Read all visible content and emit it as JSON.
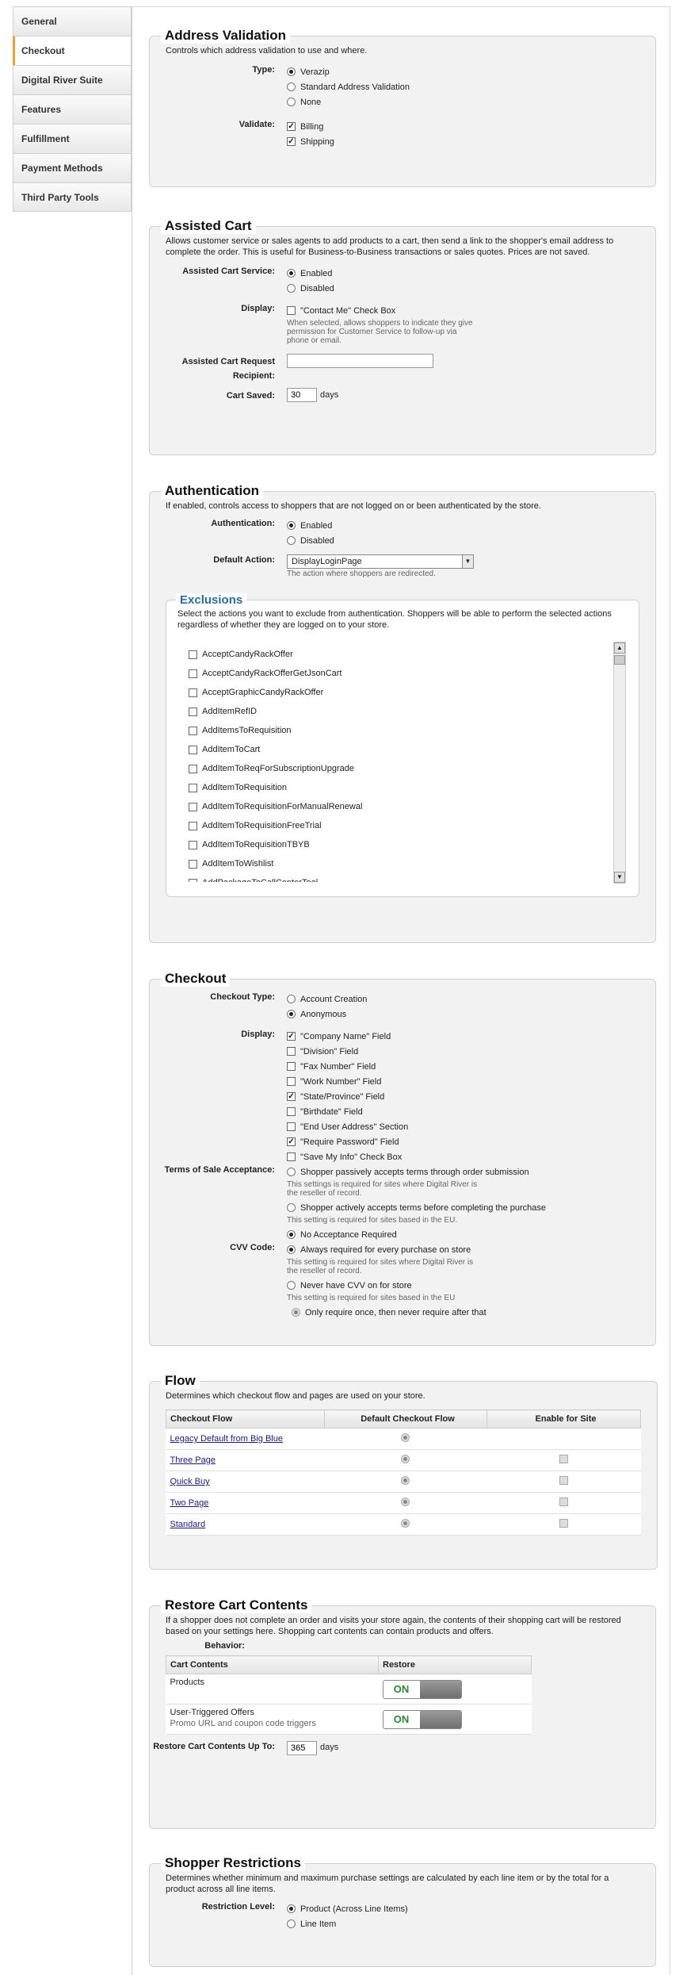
{
  "nav": {
    "items": [
      "General",
      "Checkout",
      "Digital River Suite",
      "Features",
      "Fulfillment",
      "Payment Methods",
      "Third Party Tools"
    ],
    "active_index": 1
  },
  "address_validation": {
    "title": "Address Validation",
    "description": "Controls which address validation to use and where.",
    "type_label": "Type:",
    "type_options": [
      "Verazip",
      "Standard Address Validation",
      "None"
    ],
    "type_selected": 0,
    "validate_label": "Validate:",
    "validate_options": [
      "Billing",
      "Shipping"
    ]
  },
  "assisted_cart": {
    "title": "Assisted Cart",
    "description": "Allows customer service or sales agents to add products to a cart, then send a link to the shopper's email address to complete the order. This is useful for Business-to-Business transactions or sales quotes. Prices are not saved.",
    "service_label": "Assisted Cart Service:",
    "service_options": [
      "Enabled",
      "Disabled"
    ],
    "display_label": "Display:",
    "contact_me": "\"Contact Me\" Check Box",
    "contact_hint": "When selected, allows shoppers to indicate they give permission for Customer Service to follow-up via phone or email.",
    "recipient_label": "Assisted Cart Request Recipient:",
    "recipient_value": "",
    "saved_label": "Cart Saved:",
    "saved_value": "30",
    "saved_unit": "days"
  },
  "authentication": {
    "title": "Authentication",
    "description": "If enabled, controls access to shoppers that are not logged on or been authenticated by the store.",
    "auth_label": "Authentication:",
    "auth_options": [
      "Enabled",
      "Disabled"
    ],
    "default_action_label": "Default Action:",
    "default_action_value": "DisplayLoginPage",
    "default_action_hint": "The action where shoppers are redirected.",
    "exclusions": {
      "title": "Exclusions",
      "description": "Select the actions you want to exclude from authentication. Shoppers will be able to perform the selected actions regardless of whether they are logged on to your store.",
      "items": [
        "AcceptCandyRackOffer",
        "AcceptCandyRackOfferGetJsonCart",
        "AcceptGraphicCandyRackOffer",
        "AddItemRefID",
        "AddItemsToRequisition",
        "AddItemToCart",
        "AddItemToReqForSubscriptionUpgrade",
        "AddItemToRequisition",
        "AddItemToRequisitionForManualRenewal",
        "AddItemToRequisitionFreeTrial",
        "AddItemToRequisitionTBYB",
        "AddItemToWishlist",
        "AddPackageToCallCenterTool"
      ]
    }
  },
  "checkout": {
    "title": "Checkout",
    "type_label": "Checkout Type:",
    "type_options": [
      "Account Creation",
      "Anonymous"
    ],
    "display_label": "Display:",
    "display_options": [
      {
        "label": "\"Company Name\" Field",
        "checked": true
      },
      {
        "label": "\"Division\" Field",
        "checked": false
      },
      {
        "label": "\"Fax Number\" Field",
        "checked": false
      },
      {
        "label": "\"Work Number\" Field",
        "checked": false
      },
      {
        "label": "\"State/Province\" Field",
        "checked": true
      },
      {
        "label": "\"Birthdate\" Field",
        "checked": false
      },
      {
        "label": "\"End User Address\" Section",
        "checked": false
      },
      {
        "label": "\"Require Password\" Field",
        "checked": true
      },
      {
        "label": "\"Save My Info\" Check Box",
        "checked": false
      }
    ],
    "terms_label": "Terms of Sale Acceptance:",
    "terms_options": [
      {
        "label": "Shopper passively accepts terms through order submission",
        "hint": "This settings is required for sites where Digital River is the reseller of record.",
        "checked": false
      },
      {
        "label": "Shopper actively accepts terms before completing the purchase",
        "hint": "This setting is required for sites based in the EU.",
        "checked": false
      },
      {
        "label": "No Acceptance Required",
        "hint": "",
        "checked": true
      }
    ],
    "cvv_label": "CVV Code:",
    "cvv_options": [
      {
        "label": "Always required for every purchase on store",
        "hint": "This setting is required for sites where Digital River is the reseller of record.",
        "checked": true
      },
      {
        "label": "Never have CVV on for store",
        "hint": "This setting is required for sites based in the EU",
        "checked": false
      },
      {
        "label": "Only require once, then never require after that",
        "hint": "",
        "checked": false
      }
    ]
  },
  "flow": {
    "title": "Flow",
    "description": "Determines which checkout flow and pages are used on your store.",
    "headers": [
      "Checkout Flow",
      "Default Checkout Flow",
      "Enable for Site"
    ],
    "rows": [
      "Legacy Default from Big Blue",
      "Three Page",
      "Quick Buy",
      "Two Page",
      "Standard"
    ]
  },
  "restore_cart": {
    "title": "Restore Cart Contents",
    "description": "If a shopper does not complete an order and visits your store again, the contents of their shopping cart will be restored based on your settings here. Shopping cart contents can contain products and offers.",
    "behavior_label": "Behavior:",
    "headers": [
      "Cart Contents",
      "Restore"
    ],
    "rows": [
      {
        "name": "Products",
        "sub": "",
        "state": "ON"
      },
      {
        "name": "User-Triggered Offers",
        "sub": "Promo URL and coupon code triggers",
        "state": "ON"
      }
    ],
    "up_to_label": "Restore Cart Contents Up To:",
    "up_to_value": "365",
    "up_to_unit": "days"
  },
  "shopper_restrictions": {
    "title": "Shopper Restrictions",
    "description": "Determines whether minimum and maximum purchase settings are calculated by each line item or by the total for a product across all line items.",
    "level_label": "Restriction Level:",
    "level_options": [
      "Product (Across Line Items)",
      "Line Item"
    ]
  }
}
